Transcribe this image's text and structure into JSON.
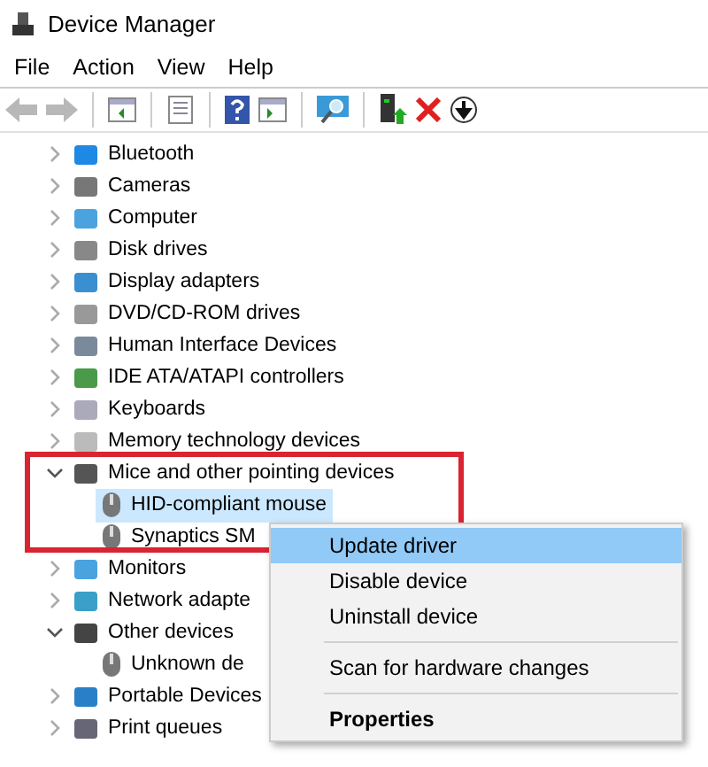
{
  "window": {
    "title": "Device Manager"
  },
  "menu": [
    "File",
    "Action",
    "View",
    "Help"
  ],
  "tree": [
    {
      "label": "Bluetooth",
      "expanded": false
    },
    {
      "label": "Cameras",
      "expanded": false
    },
    {
      "label": "Computer",
      "expanded": false
    },
    {
      "label": "Disk drives",
      "expanded": false
    },
    {
      "label": "Display adapters",
      "expanded": false
    },
    {
      "label": "DVD/CD-ROM drives",
      "expanded": false
    },
    {
      "label": "Human Interface Devices",
      "expanded": false
    },
    {
      "label": "IDE ATA/ATAPI controllers",
      "expanded": false
    },
    {
      "label": "Keyboards",
      "expanded": false
    },
    {
      "label": "Memory technology devices",
      "expanded": false
    },
    {
      "label": "Mice and other pointing devices",
      "expanded": true,
      "children": [
        {
          "label": "HID-compliant mouse",
          "selected": true
        },
        {
          "label": "Synaptics SM",
          "selected": false
        }
      ]
    },
    {
      "label": "Monitors",
      "expanded": false
    },
    {
      "label": "Network adapte",
      "expanded": false
    },
    {
      "label": "Other devices",
      "expanded": true,
      "children": [
        {
          "label": "Unknown de",
          "selected": false
        }
      ]
    },
    {
      "label": "Portable Devices",
      "expanded": false
    },
    {
      "label": "Print queues",
      "expanded": false
    }
  ],
  "context_menu": [
    {
      "kind": "item",
      "label": "Update driver",
      "selected": true
    },
    {
      "kind": "item",
      "label": "Disable device",
      "selected": false
    },
    {
      "kind": "item",
      "label": "Uninstall device",
      "selected": false
    },
    {
      "kind": "separator"
    },
    {
      "kind": "item",
      "label": "Scan for hardware changes",
      "selected": false
    },
    {
      "kind": "separator"
    },
    {
      "kind": "default",
      "label": "Properties",
      "selected": false
    }
  ]
}
